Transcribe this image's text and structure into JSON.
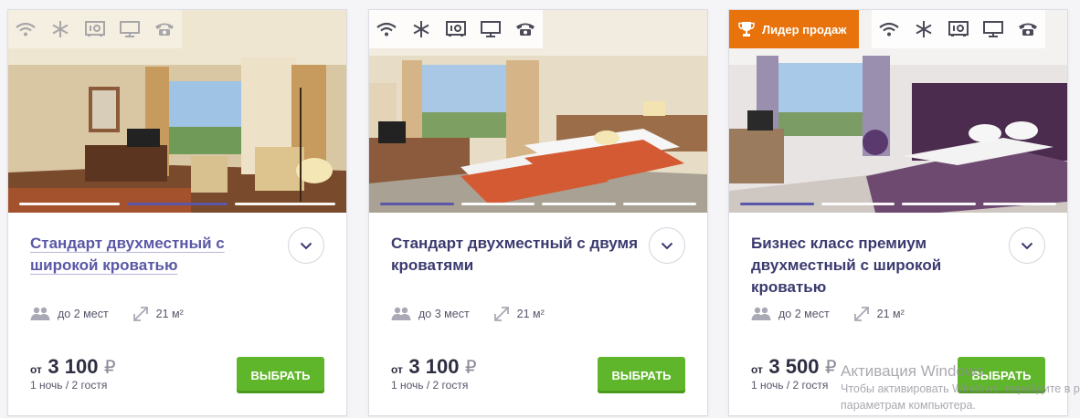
{
  "rooms": [
    {
      "title": "Стандарт двухместный с широкой кроватью",
      "title_is_link": true,
      "badge": "",
      "guests": "до 2 мест",
      "area": "21 м²",
      "price_from": "от",
      "price": "3 100",
      "currency": "₽",
      "nights": "1 ночь / 2 гостя",
      "button": "ВЫБРАТЬ",
      "amenities": [
        "wifi-icon",
        "air-conditioning-icon",
        "safe-icon",
        "tv-icon",
        "phone-icon"
      ],
      "slides": 4,
      "active_slide": 2
    },
    {
      "title": "Стандарт двухместный с двумя кроватями",
      "title_is_link": false,
      "badge": "",
      "guests": "до 3 мест",
      "area": "21 м²",
      "price_from": "от",
      "price": "3 100",
      "currency": "₽",
      "nights": "1 ночь / 2 гостя",
      "button": "ВЫБРАТЬ",
      "amenities": [
        "wifi-icon",
        "air-conditioning-icon",
        "safe-icon",
        "tv-icon",
        "phone-icon"
      ],
      "slides": 4,
      "active_slide": 1
    },
    {
      "title": "Бизнес класс премиум двухместный с широкой кроватью",
      "title_is_link": false,
      "badge": "Лидер продаж",
      "guests": "до 2 мест",
      "area": "21 м²",
      "price_from": "от",
      "price": "3 500",
      "currency": "₽",
      "nights": "1 ночь / 2 гостя",
      "button": "ВЫБРАТЬ",
      "amenities": [
        "wifi-icon",
        "air-conditioning-icon",
        "safe-icon",
        "tv-icon",
        "phone-icon"
      ],
      "slides": 4,
      "active_slide": 1
    }
  ],
  "watermark": {
    "line1": "Активация Windows",
    "line2": "Чтобы активировать Windows, перейдите в раздел",
    "line3": "параметрам компьютера."
  },
  "colors": {
    "title": "#3b3a6f",
    "link": "#5a58a6",
    "button": "#5fb62a",
    "badge": "#e8730c",
    "active_slide": "#5a57a8"
  }
}
